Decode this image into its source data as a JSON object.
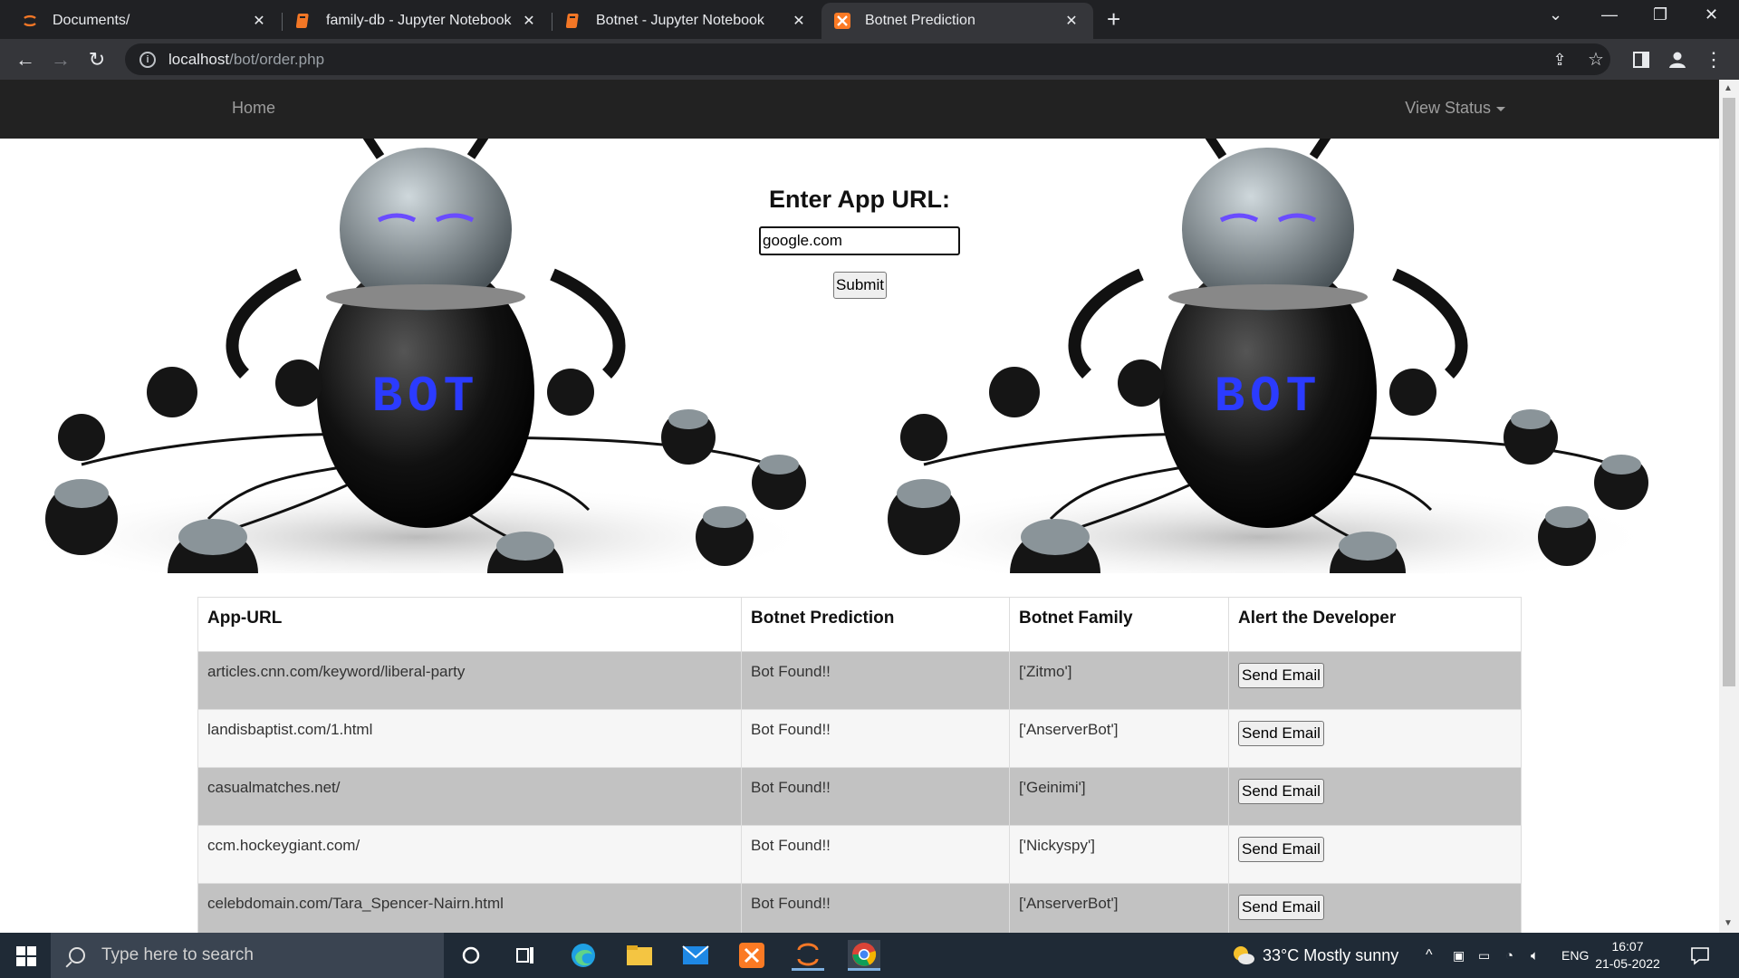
{
  "browser": {
    "tabs": [
      {
        "title": "Documents/",
        "icon": "jupyter-icon"
      },
      {
        "title": "family-db - Jupyter Notebook",
        "icon": "notebook-icon"
      },
      {
        "title": "Botnet - Jupyter Notebook",
        "icon": "notebook-icon"
      },
      {
        "title": "Botnet Prediction",
        "icon": "xampp-icon"
      }
    ],
    "active_tab": 3,
    "url_host": "localhost",
    "url_path": "/bot/order.php"
  },
  "nav": {
    "home": "Home",
    "view_status": "View Status"
  },
  "form": {
    "label": "Enter App URL:",
    "input_value": "google.com",
    "submit": "Submit"
  },
  "table": {
    "headers": [
      "App-URL",
      "Botnet Prediction",
      "Botnet Family",
      "Alert the Developer"
    ],
    "rows": [
      {
        "url": "articles.cnn.com/keyword/liberal-party",
        "prediction": "Bot Found!!",
        "family": "['Zitmo']",
        "action": "Send Email"
      },
      {
        "url": "landisbaptist.com/1.html",
        "prediction": "Bot Found!!",
        "family": "['AnserverBot']",
        "action": "Send Email"
      },
      {
        "url": "casualmatches.net/",
        "prediction": "Bot Found!!",
        "family": "['Geinimi']",
        "action": "Send Email"
      },
      {
        "url": "ccm.hockeygiant.com/",
        "prediction": "Bot Found!!",
        "family": "['Nickyspy']",
        "action": "Send Email"
      },
      {
        "url": "celebdomain.com/Tara_Spencer-Nairn.html",
        "prediction": "Bot Found!!",
        "family": "['AnserverBot']",
        "action": "Send Email"
      }
    ]
  },
  "taskbar": {
    "search_placeholder": "Type here to search",
    "weather": "33°C  Mostly sunny",
    "language": "ENG",
    "time": "16:07",
    "date": "21-05-2022"
  },
  "colors": {
    "navbar": "#222222",
    "row_odd": "#c2c2c2",
    "row_even": "#f6f6f6",
    "taskbar": "#1f2a36"
  }
}
